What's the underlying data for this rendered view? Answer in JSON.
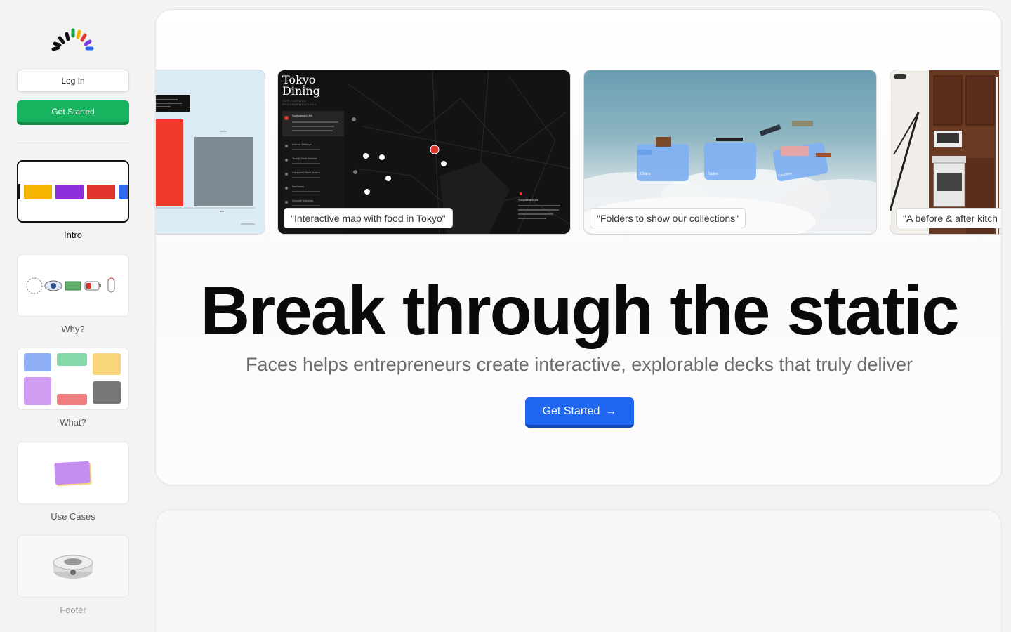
{
  "sidebar": {
    "login_label": "Log In",
    "get_started_label": "Get Started",
    "slides": [
      {
        "label": "Intro"
      },
      {
        "label": "Why?"
      },
      {
        "label": "What?"
      },
      {
        "label": "Use Cases"
      },
      {
        "label": "Footer"
      }
    ]
  },
  "carousel": {
    "cards": [
      {
        "caption": ""
      },
      {
        "caption": "\"Interactive map with food in Tokyo\"",
        "title": "Tokyo Dining",
        "subtitle": "OUR CURATED RECOMMENDATIONS",
        "selected_place": "Sukiyabashi Jiro",
        "places": [
          "Sukiyabashi Jiro",
          "Ichiran Shibuya",
          "Tsukiji Outer Market",
          "Ganpachi Nishi-Azabu",
          "Narisawa",
          "Omoide Yokocho"
        ]
      },
      {
        "caption": "\"Folders to show our collections\"",
        "folders": [
          "Chairs",
          "Tables",
          "Couches"
        ]
      },
      {
        "caption": "\"A before & after kitch"
      }
    ]
  },
  "hero": {
    "title": "Break through the static",
    "subtitle": "Faces helps entrepreneurs create interactive, explorable decks that truly deliver",
    "cta_label": "Get Started",
    "cta_arrow": "→"
  },
  "colors": {
    "accent_blue": "#1f66f0",
    "accent_green": "#19b460",
    "logo": [
      "#111111",
      "#111111",
      "#111111",
      "#1aa34a",
      "#f5b400",
      "#e2362c",
      "#7b3fe4",
      "#2f6bf2"
    ]
  }
}
